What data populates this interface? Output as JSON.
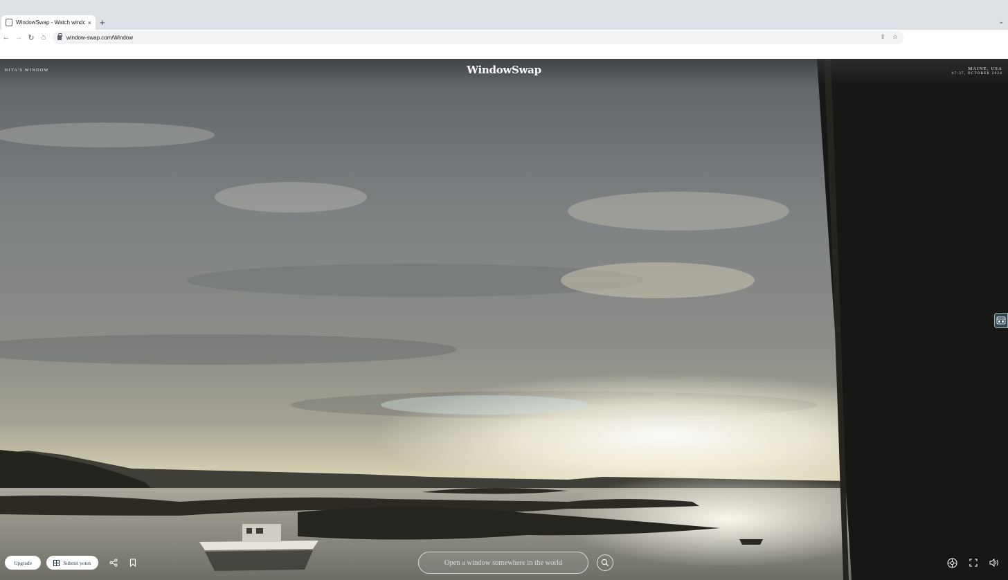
{
  "browser": {
    "tab_title": "WindowSwap - Watch windows",
    "tab_close": "×",
    "new_tab": "+",
    "tab_search": "⌄",
    "back": "←",
    "forward": "→",
    "reload": "↻",
    "home": "⌂",
    "url": "window-swap.com/Window",
    "share": "⇪",
    "bookmark": "☆"
  },
  "page": {
    "window_owner": "RITA'S WINDOW",
    "logo": "WindowSwap",
    "location": "MAINE, USA",
    "datetime": "07:37, OCTOBER 2024",
    "upgrade_label": "Upgrade",
    "submit_label": "Submit yours",
    "search_placeholder": "Open a window somewhere in the world"
  }
}
